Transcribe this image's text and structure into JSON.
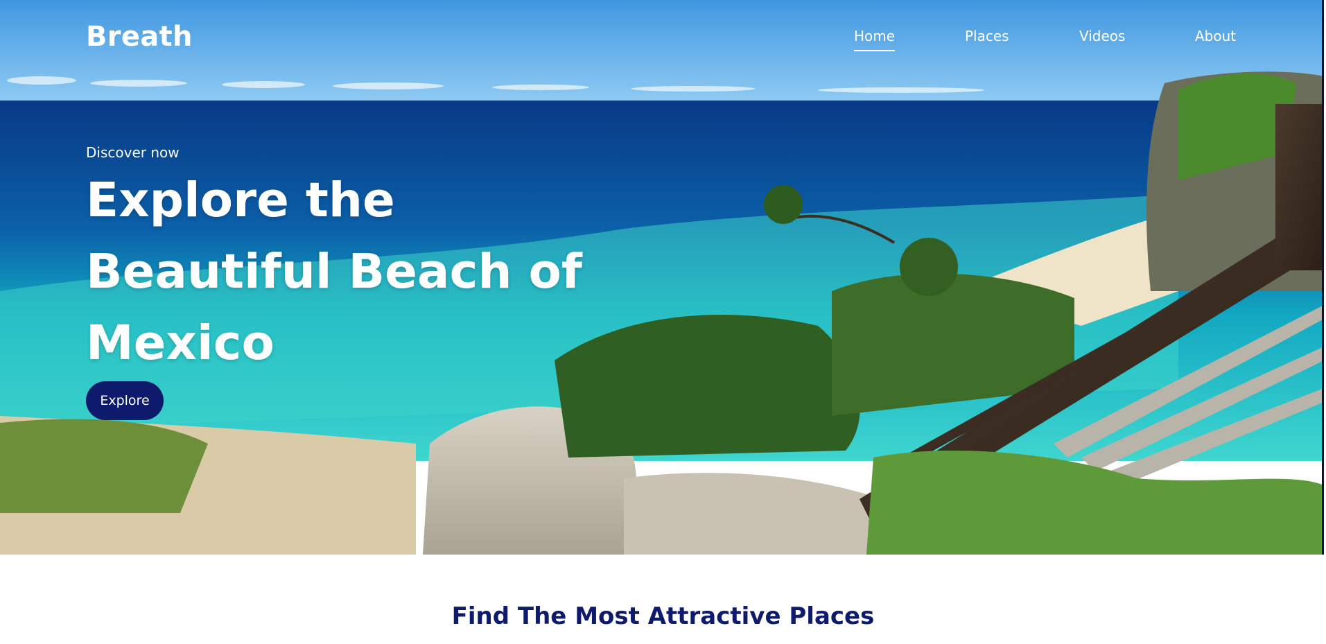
{
  "brand": {
    "logo_text": "Breath"
  },
  "nav": {
    "items": [
      {
        "label": "Home",
        "active": true
      },
      {
        "label": "Places",
        "active": false
      },
      {
        "label": "Videos",
        "active": false
      },
      {
        "label": "About",
        "active": false
      }
    ]
  },
  "hero": {
    "eyebrow": "Discover now",
    "title": "Explore the Beautiful Beach of Mexico",
    "cta_label": "Explore"
  },
  "section": {
    "heading": "Find The Most Attractive Places"
  },
  "colors": {
    "brand_navy": "#0e1a6b",
    "white": "#ffffff",
    "sky": "#4fa7e6",
    "deep_sea": "#0a3f8c",
    "turquoise": "#22c6c8",
    "sand": "#e3d6b8",
    "foliage": "#3f7a2c"
  }
}
